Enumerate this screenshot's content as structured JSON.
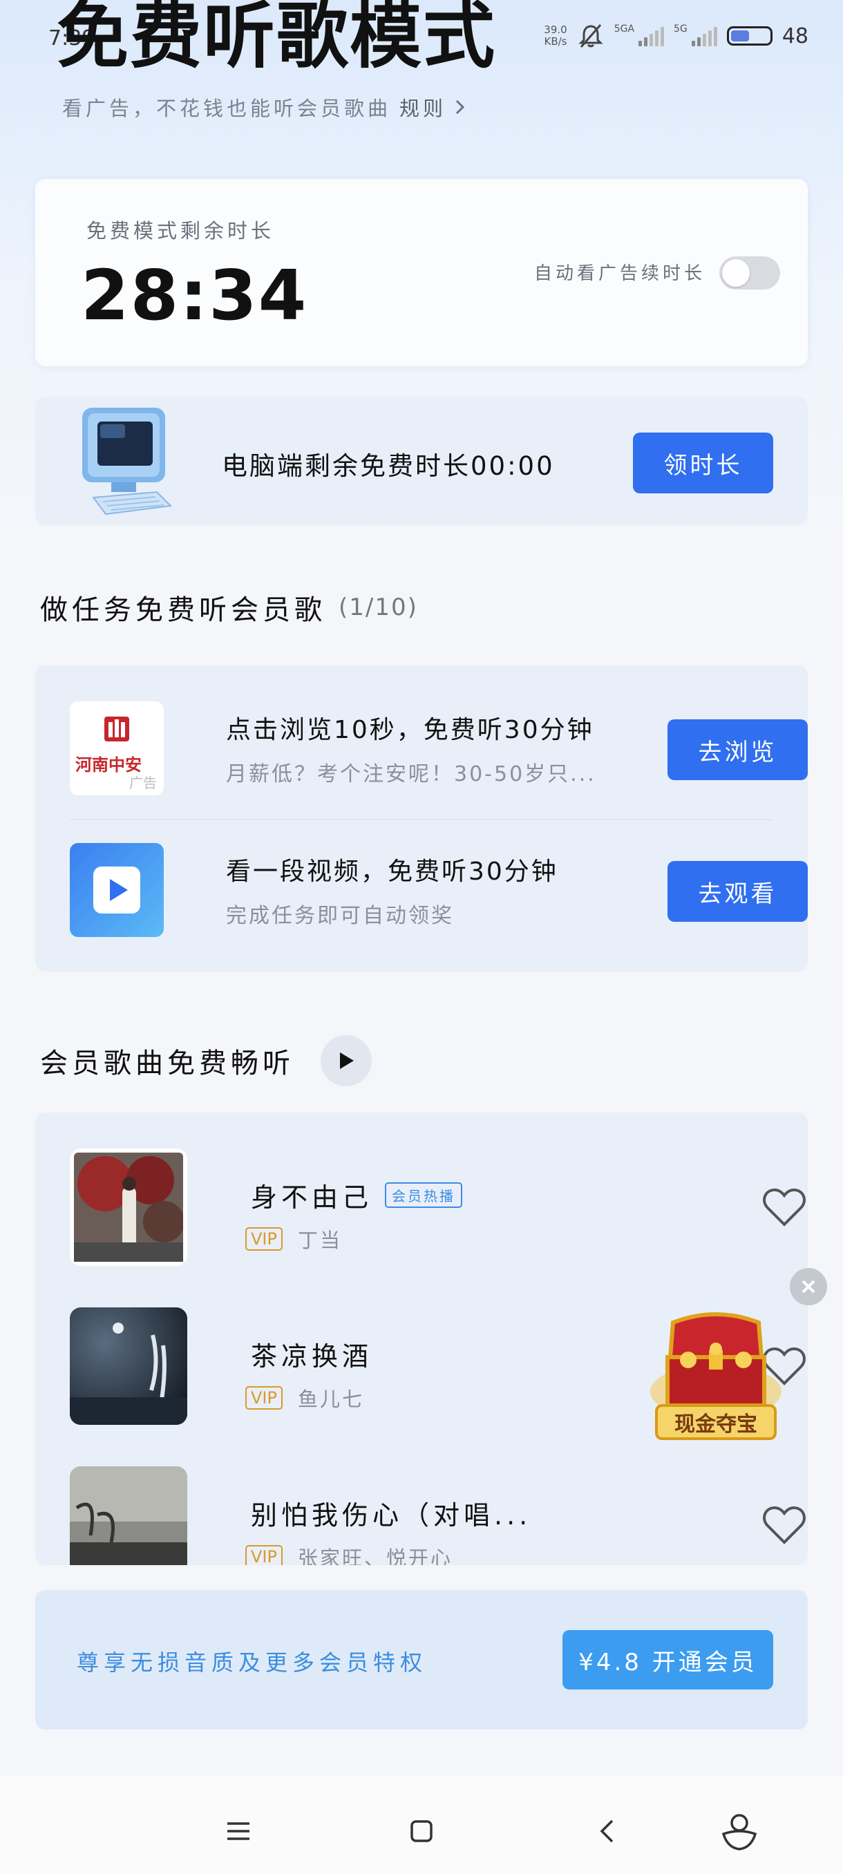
{
  "status_bar": {
    "time": "7:39",
    "net_speed_value": "39.0",
    "net_speed_unit": "KB/s",
    "sim1_label": "5GA",
    "sim2_label": "5G",
    "battery_level": 48,
    "battery_text": "48"
  },
  "header": {
    "title": "免费听歌模式",
    "subtitle": "看广告，不花钱也能听会员歌曲",
    "rules_link": "规则"
  },
  "timer_card": {
    "label": "免费模式剩余时长",
    "time_remaining": "28:34",
    "auto_label": "自动看广告续时长",
    "auto_enabled": false
  },
  "pc_card": {
    "text": "电脑端剩余免费时长00:00",
    "button": "领时长"
  },
  "tasks": {
    "title": "做任务免费听会员歌",
    "count": "(1/10)",
    "items": [
      {
        "icon_label": "河南中安",
        "ad_tag": "广告",
        "title": "点击浏览10秒，免费听30分钟",
        "subtitle": "月薪低？考个注安呢！30-50岁只...",
        "button": "去浏览"
      },
      {
        "title": "看一段视频，免费听30分钟",
        "subtitle": "完成任务即可自动领奖",
        "button": "去观看"
      }
    ]
  },
  "songs": {
    "title": "会员歌曲免费畅听",
    "items": [
      {
        "title": "身不由己",
        "badge": "会员热播",
        "vip": "VIP",
        "artist": "丁当"
      },
      {
        "title": "茶凉换酒",
        "vip": "VIP",
        "artist": "鱼儿七"
      },
      {
        "title": "别怕我伤心（对唱...",
        "vip": "VIP",
        "artist": "张家旺、悦开心"
      }
    ]
  },
  "floating": {
    "treasure_label": "现金夺宝"
  },
  "vip_bar": {
    "promo": "尊享无损音质及更多会员特权",
    "button": "¥4.8 开通会员"
  }
}
